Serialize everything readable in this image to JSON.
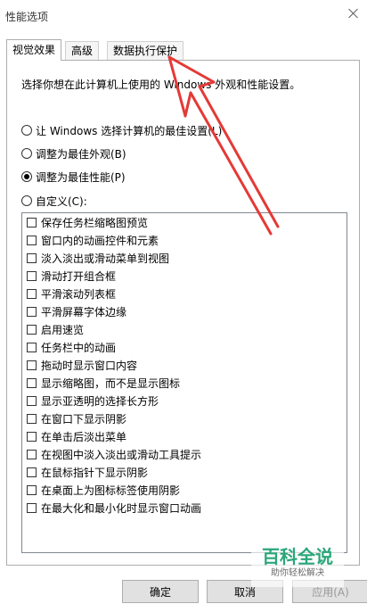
{
  "window": {
    "title": "性能选项"
  },
  "tabs": [
    "视觉效果",
    "高级",
    "数据执行保护"
  ],
  "description": "选择你想在此计算机上使用的 Windows 外观和性能设置。",
  "options": [
    {
      "label": "让 Windows 选择计算机的最佳设置(L)",
      "checked": false
    },
    {
      "label": "调整为最佳外观(B)",
      "checked": false
    },
    {
      "label": "调整为最佳性能(P)",
      "checked": true
    },
    {
      "label": "自定义(C):",
      "checked": false
    }
  ],
  "effects": [
    "保存任务栏缩略图预览",
    "窗口内的动画控件和元素",
    "淡入淡出或滑动菜单到视图",
    "滑动打开组合框",
    "平滑滚动列表框",
    "平滑屏幕字体边缘",
    "启用速览",
    "任务栏中的动画",
    "拖动时显示窗口内容",
    "显示缩略图，而不是显示图标",
    "显示亚透明的选择长方形",
    "在窗口下显示阴影",
    "在单击后淡出菜单",
    "在视图中淡入淡出或滑动工具提示",
    "在鼠标指针下显示阴影",
    "在桌面上为图标标签使用阴影",
    "在最大化和最小化时显示窗口动画"
  ],
  "buttons": {
    "ok": "确定",
    "cancel": "取消",
    "apply": "应用(A)"
  },
  "watermark": {
    "main": "百科全说",
    "sub": "助你轻松解决"
  },
  "colors": {
    "annotation_arrow": "#e53935",
    "watermark": "#2aa77a"
  }
}
